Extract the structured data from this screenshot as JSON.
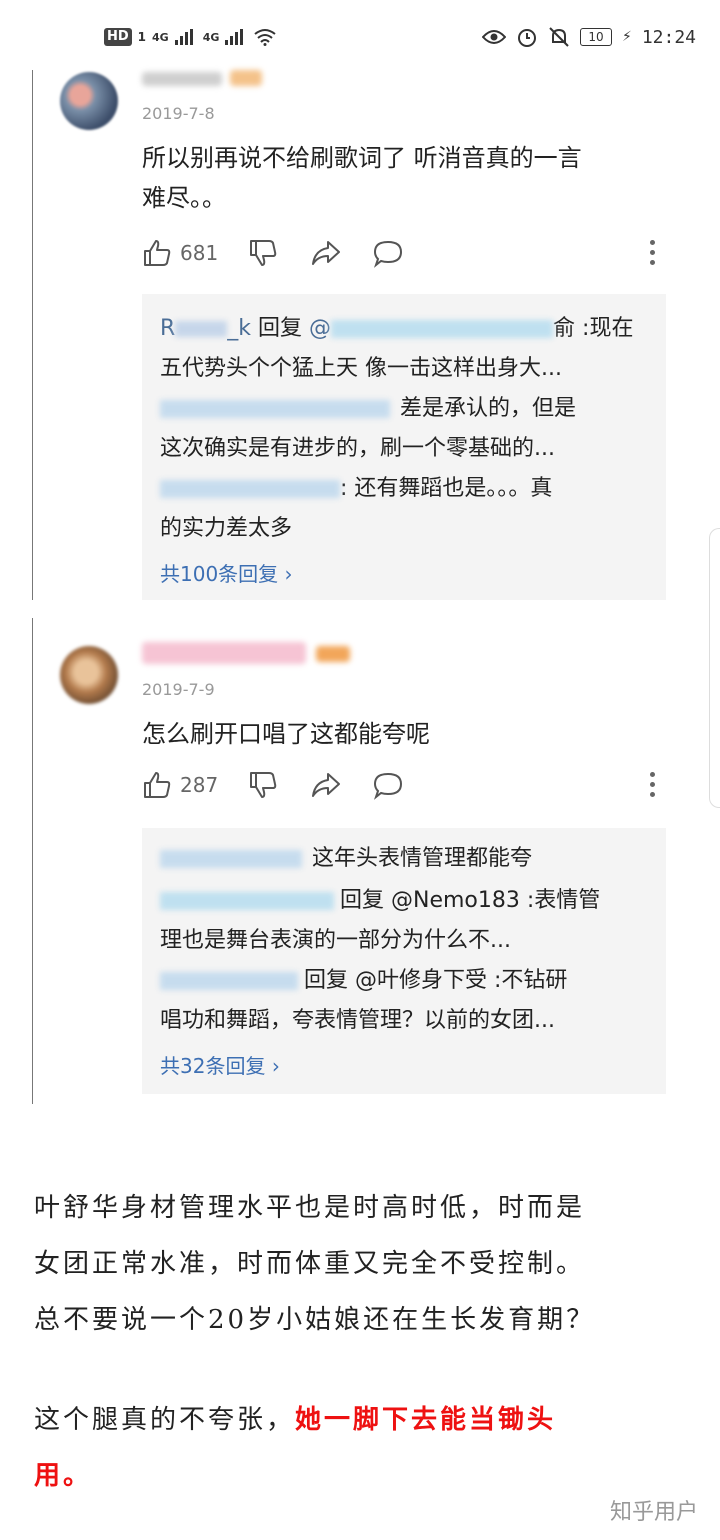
{
  "status_bar": {
    "hd": "HD",
    "sim": "1",
    "network1": "4G",
    "network2": "4G",
    "battery": "10",
    "time": "12:24"
  },
  "comments": [
    {
      "date": "2019-7-8",
      "text_line1": "所以别再说不给刷歌词了 听消音真的一言",
      "text_line2": "难尽。。",
      "likes": "681",
      "replies": [
        {
          "name": "R",
          "name_tail": "_k",
          "mid": " 回复 ",
          "at": "@",
          "at_tail": "俞",
          "text": " :现在"
        },
        {
          "text": "五代势头个个猛上天 像一击这样出身大..."
        },
        {
          "text": "差是承认的，但是"
        },
        {
          "text": "这次确实是有进步的，刷一个零基础的..."
        },
        {
          "text": ": 还有舞蹈也是。。。真"
        },
        {
          "text": "的实力差太多"
        }
      ],
      "more": "共100条回复"
    },
    {
      "date": "2019-7-9",
      "text_line1": "怎么刷开口唱了这都能夸呢",
      "likes": "287",
      "replies": [
        {
          "text": "这年头表情管理都能夸"
        },
        {
          "text": "回复 @Nemo183 :表情管"
        },
        {
          "text": "理也是舞台表演的一部分为什么不..."
        },
        {
          "text": "回复 @叶修身下受 :不钻研"
        },
        {
          "text": "唱功和舞蹈，夸表情管理？以前的女团..."
        }
      ],
      "more": "共32条回复"
    }
  ],
  "body_text": {
    "p1_line1": "叶舒华身材管理水平也是时高时低，时而是",
    "p1_line2": "女团正常水准，时而体重又完全不受控制。",
    "p1_line3": "总不要说一个20岁小姑娘还在生长发育期？",
    "p2_normal": "这个腿真的不夸张，",
    "p2_red1": "她一脚下去能当锄头",
    "p2_red2": "用。"
  },
  "watermark": "知乎用户",
  "colors": {
    "link": "#3d6fb3",
    "red_text": "#ee1111",
    "reply_bg": "#f4f4f4"
  }
}
